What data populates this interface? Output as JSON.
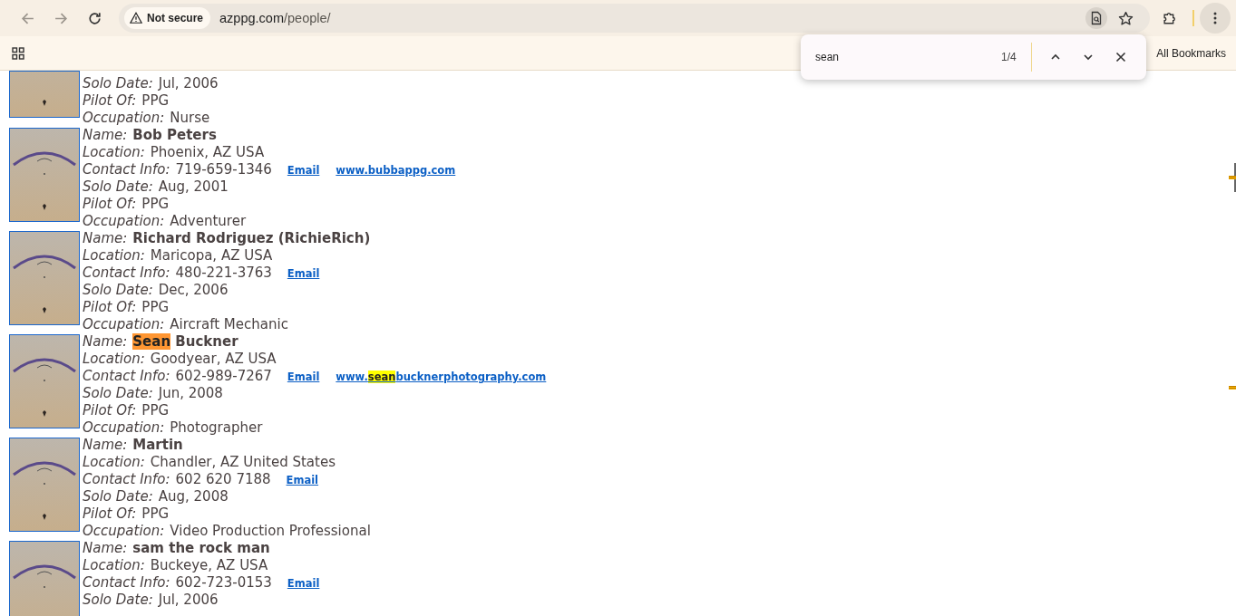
{
  "address_bar": {
    "security": "Not secure",
    "host": "azppg.com",
    "path": "/people/"
  },
  "bookmarks_bar": {
    "all_bookmarks": "All Bookmarks"
  },
  "find_bar": {
    "query": "sean",
    "count": "1/4"
  },
  "people": [
    {
      "partial": true,
      "fields": [
        {
          "kind": "text",
          "label": "Solo Date:",
          "value": "Jul, 2006"
        },
        {
          "kind": "text",
          "label": "Pilot Of:",
          "value": "PPG"
        },
        {
          "kind": "text",
          "label": "Occupation:",
          "value": "Nurse"
        }
      ]
    },
    {
      "partial": false,
      "fields": [
        {
          "kind": "name",
          "label": "Name:",
          "value": "Bob Peters"
        },
        {
          "kind": "text",
          "label": "Location:",
          "value": "Phoenix, AZ USA"
        },
        {
          "kind": "contact",
          "label": "Contact Info:",
          "value": "719-659-1346",
          "links": [
            {
              "kind": "email",
              "value": "Email"
            },
            {
              "kind": "website",
              "value": "www.bubbappg.com"
            }
          ]
        },
        {
          "kind": "text",
          "label": "Solo Date:",
          "value": "Aug, 2001"
        },
        {
          "kind": "text",
          "label": "Pilot Of:",
          "value": "PPG"
        },
        {
          "kind": "text",
          "label": "Occupation:",
          "value": "Adventurer"
        }
      ]
    },
    {
      "partial": false,
      "fields": [
        {
          "kind": "name",
          "label": "Name:",
          "value": "Richard Rodriguez (RichieRich)"
        },
        {
          "kind": "text",
          "label": "Location:",
          "value": "Maricopa, AZ USA"
        },
        {
          "kind": "contact",
          "label": "Contact Info:",
          "value": "480-221-3763",
          "links": [
            {
              "kind": "email",
              "value": "Email"
            }
          ]
        },
        {
          "kind": "text",
          "label": "Solo Date:",
          "value": "Dec, 2006"
        },
        {
          "kind": "text",
          "label": "Pilot Of:",
          "value": "PPG"
        },
        {
          "kind": "text",
          "label": "Occupation:",
          "value": "Aircraft Mechanic"
        }
      ]
    },
    {
      "partial": false,
      "fields": [
        {
          "kind": "name",
          "label": "Name:",
          "value": [
            {
              "text": "Sean",
              "highlighted": true,
              "selected": true
            },
            {
              "text": " Buckner"
            }
          ]
        },
        {
          "kind": "text",
          "label": "Location:",
          "value": "Goodyear, AZ USA"
        },
        {
          "kind": "contact",
          "label": "Contact Info:",
          "value": "602-989-7267",
          "links": [
            {
              "kind": "email",
              "value": "Email"
            },
            {
              "kind": "website",
              "value": [
                {
                  "text": "www."
                },
                {
                  "text": "sean",
                  "highlighted": true,
                  "selected": false
                },
                {
                  "text": "bucknerphotography.com"
                }
              ]
            }
          ]
        },
        {
          "kind": "text",
          "label": "Solo Date:",
          "value": "Jun, 2008"
        },
        {
          "kind": "text",
          "label": "Pilot Of:",
          "value": "PPG"
        },
        {
          "kind": "text",
          "label": "Occupation:",
          "value": "Photographer"
        }
      ]
    },
    {
      "partial": false,
      "fields": [
        {
          "kind": "name",
          "label": "Name:",
          "value": "Martin"
        },
        {
          "kind": "text",
          "label": "Location:",
          "value": "Chandler, AZ United States"
        },
        {
          "kind": "contact",
          "label": "Contact Info:",
          "value": "602 620 7188",
          "links": [
            {
              "kind": "email",
              "value": "Email"
            }
          ]
        },
        {
          "kind": "text",
          "label": "Solo Date:",
          "value": "Aug, 2008"
        },
        {
          "kind": "text",
          "label": "Pilot Of:",
          "value": "PPG"
        },
        {
          "kind": "text",
          "label": "Occupation:",
          "value": "Video Production Professional"
        }
      ]
    },
    {
      "partial": false,
      "fields": [
        {
          "kind": "name",
          "label": "Name:",
          "value": "sam the rock man"
        },
        {
          "kind": "text",
          "label": "Location:",
          "value": "Buckeye, AZ USA"
        },
        {
          "kind": "contact",
          "label": "Contact Info:",
          "value": "602-723-0153",
          "links": [
            {
              "kind": "email",
              "value": "Email"
            }
          ]
        },
        {
          "kind": "text",
          "label": "Solo Date:",
          "value": "Jul, 2006"
        }
      ]
    }
  ]
}
